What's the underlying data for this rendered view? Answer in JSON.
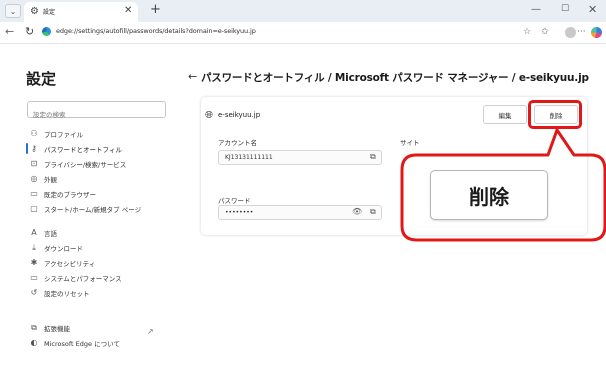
{
  "browser": {
    "tab_title": "設定",
    "tab_icon": "gear-icon",
    "address_url": "edge://settings/autofill/passwords/details?domain=e-seikyuu.jp"
  },
  "sidebar": {
    "title": "設定",
    "search_placeholder": "設定の検索",
    "items": [
      {
        "label": "プロファイル",
        "icon": "person-icon"
      },
      {
        "label": "パスワードとオートフィル",
        "icon": "key-icon",
        "active": true
      },
      {
        "label": "プライバシー/検索/サービス",
        "icon": "lock-icon"
      },
      {
        "label": "外観",
        "icon": "appearance-icon"
      },
      {
        "label": "既定のブラウザー",
        "icon": "browser-icon"
      },
      {
        "label": "スタート/ホーム/新規タブ ページ",
        "icon": "home-icon"
      },
      {
        "label": "言語",
        "icon": "language-icon"
      },
      {
        "label": "ダウンロード",
        "icon": "download-icon"
      },
      {
        "label": "アクセシビリティ",
        "icon": "accessibility-icon"
      },
      {
        "label": "システムとパフォーマンス",
        "icon": "system-icon"
      },
      {
        "label": "設定のリセット",
        "icon": "reset-icon"
      },
      {
        "label": "拡張機能",
        "icon": "extension-icon"
      },
      {
        "label": "Microsoft Edge について",
        "icon": "edge-icon"
      }
    ]
  },
  "main": {
    "heading": "パスワードとオートフィル / Microsoft パスワード マネージャー / e-seikyuu.jp",
    "site": "e-seikyuu.jp",
    "edit_label": "編集",
    "delete_label": "削除",
    "account_label": "アカウント名",
    "account_value": "KJ13131111111",
    "site_label": "サイト",
    "password_label": "パスワード",
    "password_value": "••••••••"
  },
  "callout": {
    "zoom_label": "削除",
    "color": "#e01818"
  }
}
